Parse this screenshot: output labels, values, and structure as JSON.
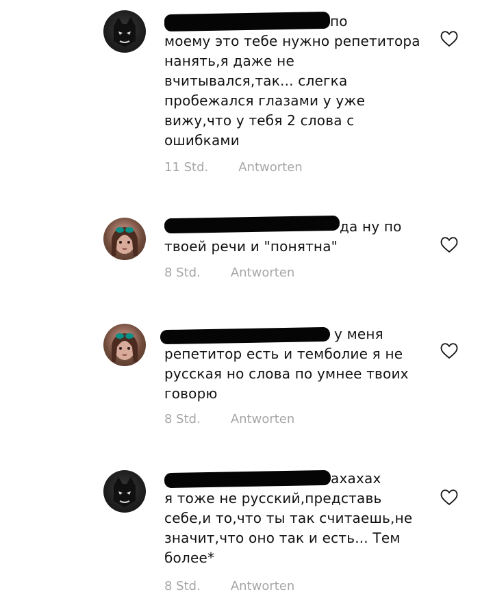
{
  "comments": [
    {
      "avatar_icon": "dark-mask-avatar",
      "avatar_style": "dark",
      "text_line_1": "по",
      "text_rest": "моему это тебе нужно репетитора нанять,я даже не вчитывался,так... слегка пробежался глазами у уже вижу,что у тебя 2 слова с ошибками",
      "time": "11 Std.",
      "reply_label": "Antworten",
      "like_icon": "heart-outline-icon"
    },
    {
      "avatar_icon": "girl-photo-avatar",
      "avatar_style": "photo",
      "text_line_1": "да ну по",
      "text_rest": "твоей речи и \"понятна\"",
      "time": "8 Std.",
      "reply_label": "Antworten",
      "like_icon": "heart-outline-icon"
    },
    {
      "avatar_icon": "girl-photo-avatar",
      "avatar_style": "photo",
      "text_line_1": "у меня",
      "text_rest": "репетитор есть и темболие я не русская но слова по умнее твоих говорю",
      "time": "8 Std.",
      "reply_label": "Antworten",
      "like_icon": "heart-outline-icon"
    },
    {
      "avatar_icon": "dark-mask-avatar",
      "avatar_style": "dark",
      "text_line_1": "ахахах",
      "text_rest": "я тоже не русский,представь себе,и то,что ты так считаешь,не значит,что оно так и есть... Тем более*",
      "time": "8 Std.",
      "reply_label": "Antworten",
      "like_icon": "heart-outline-icon"
    }
  ]
}
